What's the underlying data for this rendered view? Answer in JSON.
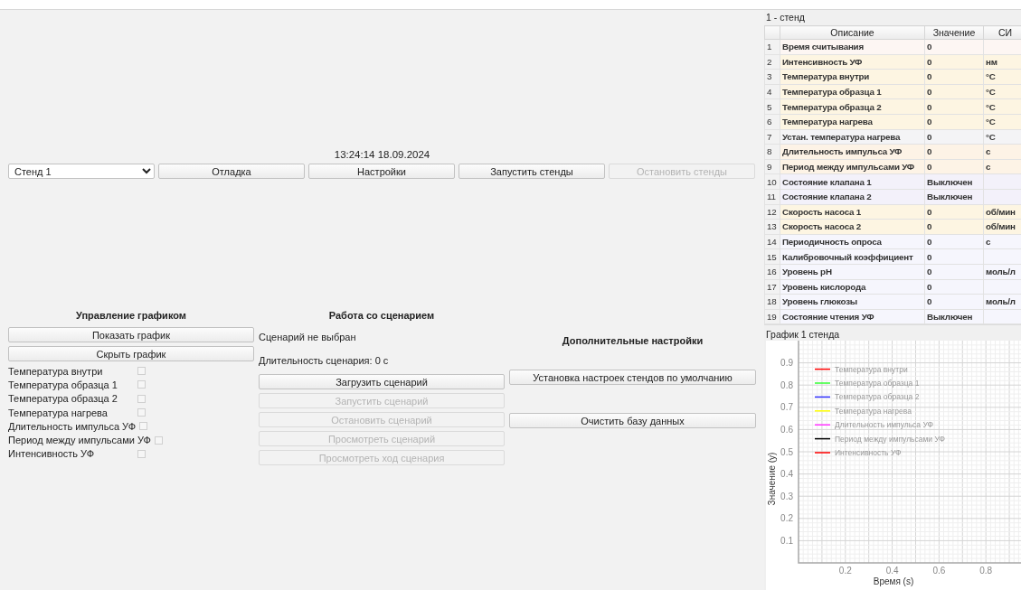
{
  "clock": "13:24:14 18.09.2024",
  "toolbar": {
    "stand_select": {
      "value": "Стенд 1"
    },
    "buttons": [
      {
        "label": "Отладка",
        "disabled": false
      },
      {
        "label": "Настройки",
        "disabled": false
      },
      {
        "label": "Запустить стенды",
        "disabled": false
      },
      {
        "label": "Остановить стенды",
        "disabled": true
      }
    ]
  },
  "chart_control": {
    "title": "Управление графиком",
    "buttons": [
      {
        "label": "Показать график",
        "disabled": false
      },
      {
        "label": "Скрыть график",
        "disabled": false
      }
    ],
    "series_toggles": [
      {
        "label": "Температура внутри",
        "checked": false
      },
      {
        "label": "Температура образца 1",
        "checked": false
      },
      {
        "label": "Температура образца 2",
        "checked": false
      },
      {
        "label": "Температура нагрева",
        "checked": false
      },
      {
        "label": "Длительность импульса УФ",
        "checked": false
      },
      {
        "label": "Период между импульсами УФ",
        "checked": false
      },
      {
        "label": "Интенсивность УФ",
        "checked": false
      }
    ]
  },
  "scenario": {
    "title": "Работа со сценарием",
    "status": "Сценарий не выбран",
    "duration": "Длительность сценария: 0 с",
    "buttons": [
      {
        "label": "Загрузить сценарий",
        "disabled": false
      },
      {
        "label": "Запустить сценарий",
        "disabled": true
      },
      {
        "label": "Остановить сценарий",
        "disabled": true
      },
      {
        "label": "Просмотреть сценарий",
        "disabled": true
      },
      {
        "label": "Просмотреть ход сценария",
        "disabled": true
      }
    ]
  },
  "extra_settings": {
    "title": "Дополнительные настройки",
    "buttons": [
      {
        "label": "Установка настроек стендов по умолчанию",
        "disabled": false
      },
      {
        "label": "Очистить базу данных",
        "disabled": false
      }
    ]
  },
  "stand_table": {
    "title": "1 - стенд",
    "columns": [
      "Описание",
      "Значение",
      "СИ"
    ],
    "rows": [
      {
        "number": "1",
        "description": "Время считывания",
        "value": "0",
        "color": "#fdf6f3"
      },
      {
        "number": "2",
        "description": "Интенсивность УФ",
        "value": "0",
        "unit": "нм",
        "color": "#fdf5e2"
      },
      {
        "number": "3",
        "description": "Температура внутри",
        "value": "0",
        "unit": "°C",
        "color": "#fdf5e2"
      },
      {
        "number": "4",
        "description": "Температура образца 1",
        "value": "0",
        "unit": "°C",
        "color": "#fdf5e2"
      },
      {
        "number": "5",
        "description": "Температура образца 2",
        "value": "0",
        "unit": "°C",
        "color": "#fdf5e2"
      },
      {
        "number": "6",
        "description": "Температура нагрева",
        "value": "0",
        "unit": "°C",
        "color": "#fdf5e2"
      },
      {
        "number": "7",
        "description": "Устан. температура нагрева",
        "value": "0",
        "unit": "°C",
        "color": "#f4f4f6"
      },
      {
        "number": "8",
        "description": "Длительность импульса УФ",
        "value": "0",
        "unit": "с",
        "color": "#fdf3e6"
      },
      {
        "number": "9",
        "description": "Период между импульсами УФ",
        "value": "0",
        "unit": "с",
        "color": "#fdf3e6"
      },
      {
        "number": "10",
        "description": "Состояние клапана 1",
        "value": "Выключен",
        "color": "#f3f1fa"
      },
      {
        "number": "11",
        "description": "Состояние клапана 2",
        "value": "Выключен",
        "color": "#f3f1fa"
      },
      {
        "number": "12",
        "description": "Скорость насоса 1",
        "value": "0",
        "unit": "об/мин",
        "color": "#fdf5e2"
      },
      {
        "number": "13",
        "description": "Скорость насоса 2",
        "value": "0",
        "unit": "об/мин",
        "color": "#fdf5e2"
      },
      {
        "number": "14",
        "description": "Периодичность опроса",
        "value": "0",
        "unit": "с",
        "color": "#f6f6fd"
      },
      {
        "number": "15",
        "description": "Калибровочный коэффициент",
        "value": "0",
        "color": "#f6f6fd"
      },
      {
        "number": "16",
        "description": "Уровень pH",
        "value": "0",
        "unit": "моль/л",
        "color": "#f6f6fd"
      },
      {
        "number": "17",
        "description": "Уровень кислорода",
        "value": "0",
        "color": "#f6f6fd"
      },
      {
        "number": "18",
        "description": "Уровень глюкозы",
        "value": "0",
        "unit": "моль/л",
        "color": "#f6f6fd"
      },
      {
        "number": "19",
        "description": "Состояние чтения УФ",
        "value": "Выключен",
        "color": "#f6f6fd"
      }
    ]
  },
  "chart_panel": {
    "title": "График 1 стенда",
    "chart_data": {
      "type": "line",
      "xlabel": "Время (s)",
      "ylabel": "Значение (y)",
      "grid": true,
      "categories": [
        "0.2",
        "0.4",
        "0.6",
        "0.8"
      ],
      "ylim": [
        0,
        1
      ],
      "yticks": [
        0.1,
        0.2,
        0.3,
        0.4,
        0.5,
        0.6,
        0.7,
        0.8,
        0.9
      ],
      "series": [
        {
          "name": "Температура внутри",
          "color": "#ff0000",
          "values": [
            null,
            null,
            null,
            null
          ]
        },
        {
          "name": "Температура образца 1",
          "color": "#33ff33",
          "values": [
            null,
            null,
            null,
            null
          ]
        },
        {
          "name": "Температура образца 2",
          "color": "#3333ff",
          "values": [
            null,
            null,
            null,
            null
          ]
        },
        {
          "name": "Температура нагрева",
          "color": "#ffff00",
          "values": [
            null,
            null,
            null,
            null
          ]
        },
        {
          "name": "Длительность импульса УФ",
          "color": "#ff33ff",
          "values": [
            null,
            null,
            null,
            null
          ]
        },
        {
          "name": "Период между импульсами УФ",
          "color": "#000000",
          "values": [
            null,
            null,
            null,
            null
          ]
        },
        {
          "name": "Интенсивность УФ",
          "color": "#ff0000",
          "values": [
            null,
            null,
            null,
            null
          ]
        }
      ]
    }
  }
}
